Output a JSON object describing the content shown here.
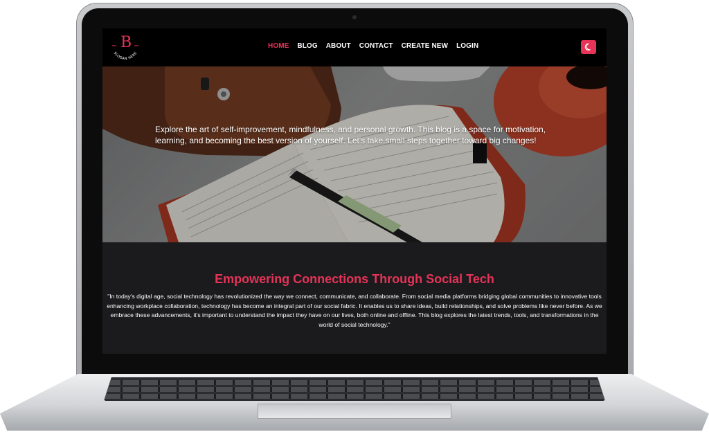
{
  "logo": {
    "letter": "B",
    "tagline": "SLOGAN HERE"
  },
  "nav": {
    "items": [
      {
        "label": "HOME",
        "active": true
      },
      {
        "label": "BLOG",
        "active": false
      },
      {
        "label": "ABOUT",
        "active": false
      },
      {
        "label": "CONTACT",
        "active": false
      },
      {
        "label": "CREATE NEW",
        "active": false
      },
      {
        "label": "LOGIN",
        "active": false
      }
    ],
    "theme_toggle_icon": "moon-icon"
  },
  "hero": {
    "text": "Explore the art of self-improvement, mindfulness, and personal growth. This blog is a space for motivation, learning, and becoming the best version of yourself. Let's take small steps together toward big changes!"
  },
  "article": {
    "title": "Empowering Connections Through Social Tech",
    "body": "\"In today's digital age, social technology has revolutionized the way we connect, communicate, and collaborate. From social media platforms bridging global communities to innovative tools enhancing workplace collaboration, technology has become an integral part of our social fabric. It enables us to share ideas, build relationships, and solve problems like never before. As we embrace these advancements, it's important to understand the impact they have on our lives, both online and offline. This blog explores the latest trends, tools, and transformations in the world of social technology.\""
  },
  "colors": {
    "accent": "#e63358",
    "nav_bg": "#000000",
    "page_bg": "#1b1b1e",
    "text": "#ffffff"
  }
}
